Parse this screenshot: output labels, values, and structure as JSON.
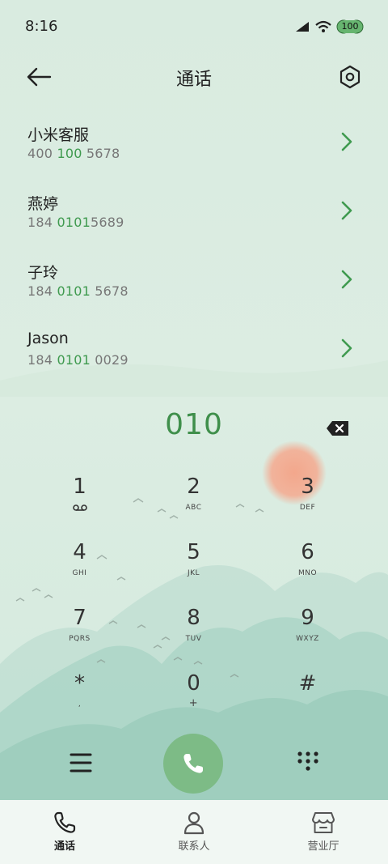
{
  "status_bar": {
    "time": "8:16",
    "battery_level": "100",
    "icons": [
      "cellular-signal-icon",
      "wifi-icon",
      "battery-icon"
    ]
  },
  "header": {
    "title": "通话",
    "back_icon": "arrow-left-icon",
    "settings_icon": "hexagon-settings-icon"
  },
  "contacts": [
    {
      "name": "小米客服",
      "number_parts": [
        "400 ",
        "100",
        " 5678"
      ]
    },
    {
      "name": "燕婷",
      "number_parts": [
        "184 ",
        "0101",
        "5689"
      ]
    },
    {
      "name": "子玲",
      "number_parts": [
        "184 ",
        "0101",
        " 5678"
      ]
    },
    {
      "name": "Jason",
      "number_parts": [
        "184 ",
        "0101",
        " 0029"
      ]
    }
  ],
  "dialer": {
    "entered_number": "010",
    "backspace_icon": "backspace-icon"
  },
  "keypad": [
    {
      "digit": "1",
      "sub": "",
      "sub_icon": "voicemail-icon"
    },
    {
      "digit": "2",
      "sub": "ABC"
    },
    {
      "digit": "3",
      "sub": "DEF"
    },
    {
      "digit": "4",
      "sub": "GHI"
    },
    {
      "digit": "5",
      "sub": "JKL"
    },
    {
      "digit": "6",
      "sub": "MNO"
    },
    {
      "digit": "7",
      "sub": "PQRS"
    },
    {
      "digit": "8",
      "sub": "TUV"
    },
    {
      "digit": "9",
      "sub": "WXYZ"
    },
    {
      "digit": "*",
      "sub": ","
    },
    {
      "digit": "0",
      "sub": "+"
    },
    {
      "digit": "#",
      "sub": ""
    }
  ],
  "actions": {
    "menu_icon": "menu-icon",
    "call_icon": "phone-icon",
    "dialpad_icon": "dialpad-icon"
  },
  "bottom_nav": [
    {
      "label": "通话",
      "icon": "phone-icon",
      "active": true
    },
    {
      "label": "联系人",
      "icon": "person-icon",
      "active": false
    },
    {
      "label": "营业厅",
      "icon": "store-icon",
      "active": false
    }
  ],
  "colors": {
    "background": "#dbece1",
    "accent_green": "#3f9a4f",
    "call_button": "#7dbb86",
    "sun": "#f1a98f",
    "nav_background": "#f1f7f3"
  }
}
